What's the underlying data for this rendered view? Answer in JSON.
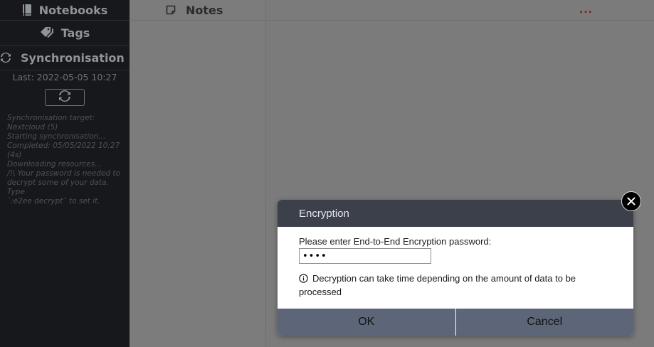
{
  "sidebar": {
    "notebooks_label": "Notebooks",
    "tags_label": "Tags",
    "sync_label": "Synchronisation",
    "last_sync": "Last: 2022-05-05 10:27",
    "sync_log": [
      "Synchronisation target:",
      "Nextcloud (5)",
      "Starting synchronisation...",
      "Completed: 05/05/2022 10:27",
      "(4s)",
      "Downloading resources...",
      "/!\\ Your password is needed to",
      "decrypt some of your data. Type",
      "`:e2ee decrypt` to set it."
    ]
  },
  "notes": {
    "header_label": "Notes"
  },
  "editor": {
    "more_menu": "..."
  },
  "dialog": {
    "title": "Encryption",
    "prompt": "Please enter End-to-End Encryption password:",
    "password_value": "abcd",
    "hint": "Decryption can take time depending on the amount of data to be processed",
    "ok_label": "OK",
    "cancel_label": "Cancel"
  },
  "colors": {
    "sidebar_bg": "#16181b",
    "overlay_bg": "#7b7b7b",
    "dialog_header": "#3b404a",
    "dialog_buttons": "#5c6678",
    "more_dots": "#7a1e1e"
  }
}
